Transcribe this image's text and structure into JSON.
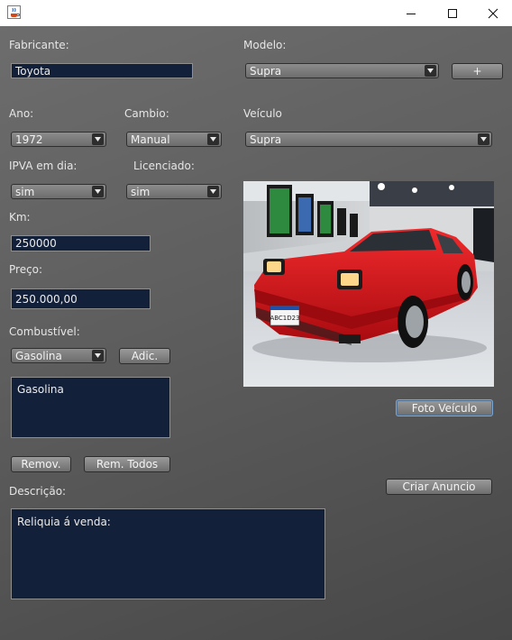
{
  "window": {
    "title": ""
  },
  "labels": {
    "fabricante": "Fabricante:",
    "modelo": "Modelo:",
    "ano": "Ano:",
    "cambio": "Cambio:",
    "veiculo": "Veículo",
    "ipva": "IPVA em dia:",
    "licenciado": "Licenciado:",
    "km": "Km:",
    "preco": "Preço:",
    "combustivel": "Combustível:",
    "descricao": "Descrição:"
  },
  "fields": {
    "fabricante": "Toyota",
    "km": "250000",
    "preco": "250.000,00"
  },
  "combos": {
    "modelo": "Supra",
    "ano": "1972",
    "cambio": "Manual",
    "veiculo": "Supra",
    "ipva": "sim",
    "licenciado": "sim",
    "combustivel": "Gasolina"
  },
  "buttons": {
    "add_modelo": "+",
    "adic": "Adic.",
    "remov": "Remov.",
    "rem_todos": "Rem. Todos",
    "foto_veiculo": "Foto Veículo",
    "criar_anuncio": "Criar Anuncio"
  },
  "lists": {
    "combustivel_items": [
      "Gasolina"
    ]
  },
  "descricao_text": "Reliquia á venda:",
  "photo": {
    "plate_text": "ABC1D23"
  },
  "colors": {
    "field_bg": "#13203a",
    "car_red": "#d8161a",
    "focus_border": "#7aa6d6"
  },
  "icons": [
    "java-app-icon",
    "minimize-icon",
    "maximize-icon",
    "close-icon",
    "dropdown-arrow-icon"
  ]
}
